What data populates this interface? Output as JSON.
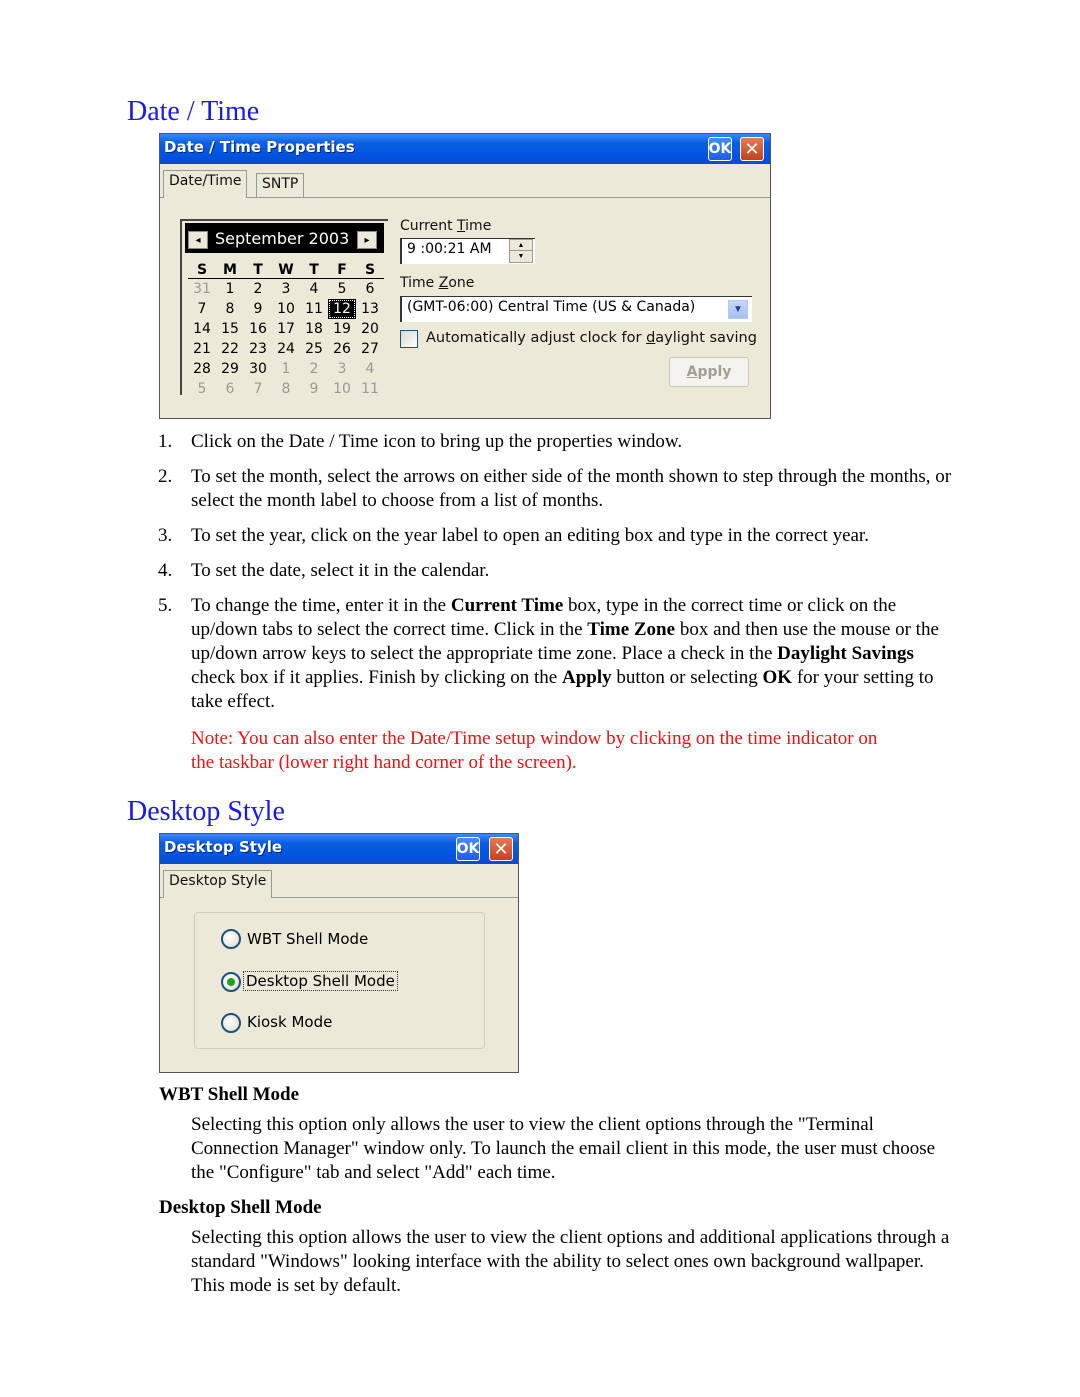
{
  "sections": {
    "datetime_heading": "Date / Time",
    "desktop_heading": "Desktop Style"
  },
  "datetime_window": {
    "title": "Date / Time Properties",
    "ok_label": "OK",
    "close_label": "✕",
    "tabs": [
      "Date/Time",
      "SNTP"
    ],
    "calendar": {
      "month_year": "September 2003",
      "prev_icon": "◂",
      "next_icon": "▸",
      "weekdays": [
        "S",
        "M",
        "T",
        "W",
        "T",
        "F",
        "S"
      ],
      "selected_day": "12",
      "weeks": [
        [
          "31",
          "1",
          "2",
          "3",
          "4",
          "5",
          "6"
        ],
        [
          "7",
          "8",
          "9",
          "10",
          "11",
          "12",
          "13"
        ],
        [
          "14",
          "15",
          "16",
          "17",
          "18",
          "19",
          "20"
        ],
        [
          "21",
          "22",
          "23",
          "24",
          "25",
          "26",
          "27"
        ],
        [
          "28",
          "29",
          "30",
          "1",
          "2",
          "3",
          "4"
        ],
        [
          "5",
          "6",
          "7",
          "8",
          "9",
          "10",
          "11"
        ]
      ]
    },
    "current_time_label_pre": "Current ",
    "current_time_label_u": "T",
    "current_time_label_post": "ime",
    "current_time_value": "9 :00:21 AM",
    "time_zone_label_pre": "Time ",
    "time_zone_label_u": "Z",
    "time_zone_label_post": "one",
    "time_zone_value": "(GMT-06:00) Central Time (US & Canada)",
    "daylight_label_pre": "Automatically adjust clock for ",
    "daylight_label_u": "d",
    "daylight_label_post": "aylight saving",
    "daylight_checked": false,
    "apply_label_u": "A",
    "apply_label_post": "pply"
  },
  "steps": [
    {
      "num": "1.",
      "text": "Click on the Date / Time icon to bring up the properties window."
    },
    {
      "num": "2.",
      "text": "To set the month, select the arrows on either side of the month shown to step through the months, or select the month label to choose from a list of months."
    },
    {
      "num": "3.",
      "text": "To set the year, click on the year label to open an editing box and type in the correct year."
    },
    {
      "num": "4.",
      "text": "To set the date, select it in the calendar."
    },
    {
      "num": "5.",
      "parts": [
        "To change the time, enter it in the ",
        "Current Time",
        " box, type in the correct time or click on the up/down tabs to select the correct time.  Click in the ",
        "Time Zone",
        " box and then use the mouse or the up/down arrow keys to select the appropriate time zone.  Place a check in the ",
        "Daylight Savings",
        " check box if it applies.  Finish by clicking on the ",
        "Apply",
        " button or selecting ",
        "OK",
        " for your setting to take effect."
      ]
    }
  ],
  "note": "Note:  You can also enter the Date/Time setup window by clicking on the time indicator on the taskbar (lower right hand corner of the screen).",
  "desktop_window": {
    "title": "Desktop Style",
    "ok_label": "OK",
    "close_label": "✕",
    "tab": "Desktop Style",
    "options": [
      "WBT Shell Mode",
      "Desktop Shell Mode",
      "Kiosk Mode"
    ],
    "selected": "Desktop Shell Mode"
  },
  "modes": [
    {
      "title": "WBT Shell Mode",
      "text": "Selecting this option only allows the user to view the client options through the \"Terminal Connection Manager\" window only.  To launch the email client in this mode, the user must choose the \"Configure\" tab and select \"Add\" each time."
    },
    {
      "title": "Desktop Shell Mode",
      "text": "Selecting this option allows the user to view the client options and additional applications through a standard \"Windows\" looking interface with the ability to select ones own background wallpaper.  This mode is set by default."
    }
  ],
  "colors": {
    "heading": "#1a1ae6",
    "note": "#ee1111",
    "titlebar": "#0054e3",
    "dialog": "#ece9d8"
  }
}
